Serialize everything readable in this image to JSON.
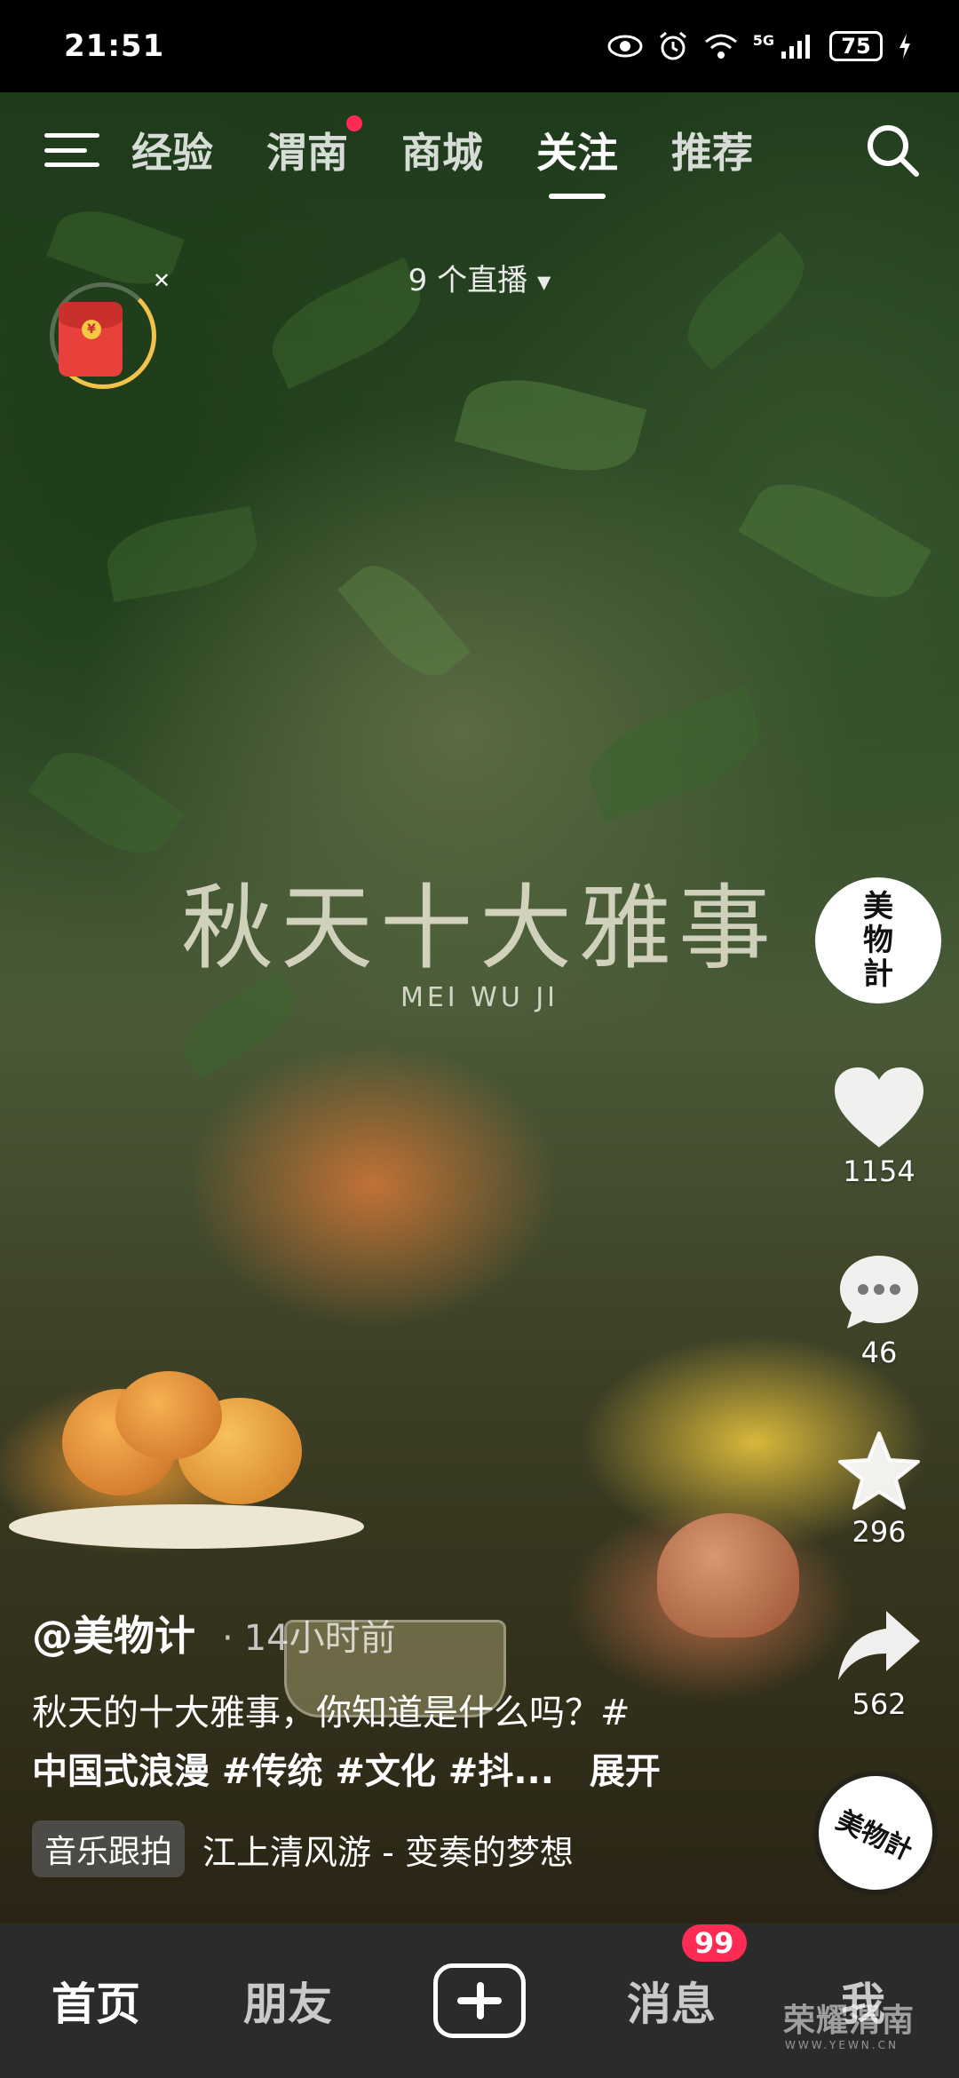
{
  "status_bar": {
    "time": "21:51",
    "battery": "75",
    "network": "5G"
  },
  "top_nav": {
    "tabs": [
      {
        "label": "经验",
        "active": false,
        "dot": false
      },
      {
        "label": "渭南",
        "active": false,
        "dot": true
      },
      {
        "label": "商城",
        "active": false,
        "dot": false
      },
      {
        "label": "关注",
        "active": true,
        "dot": false
      },
      {
        "label": "推荐",
        "active": false,
        "dot": false
      }
    ],
    "live_count": "9 个直播"
  },
  "video": {
    "title": "秋天十大雅事",
    "subtitle": "MEI WU JI"
  },
  "right_rail": {
    "author_avatar_text": [
      "美",
      "物",
      "計"
    ],
    "like_count": "1154",
    "comment_count": "46",
    "favorite_count": "296",
    "share_count": "562",
    "music_disc_text": "美物計"
  },
  "caption": {
    "author": "@美物计",
    "time": "14小时前",
    "desc_line1": "秋天的十大雅事，你知道是什么吗？#",
    "desc_line2": "中国式浪漫 #传统 #文化 #抖...",
    "expand": "展开",
    "music_badge": "音乐跟拍",
    "music_title": "江上清风游 - 变奏的梦想"
  },
  "bottom_nav": {
    "home": "首页",
    "friends": "朋友",
    "messages": "消息",
    "messages_badge": "99",
    "me": "我"
  },
  "watermark": {
    "text": "荣耀渭南",
    "sub": "WWW.YEWN.CN"
  }
}
